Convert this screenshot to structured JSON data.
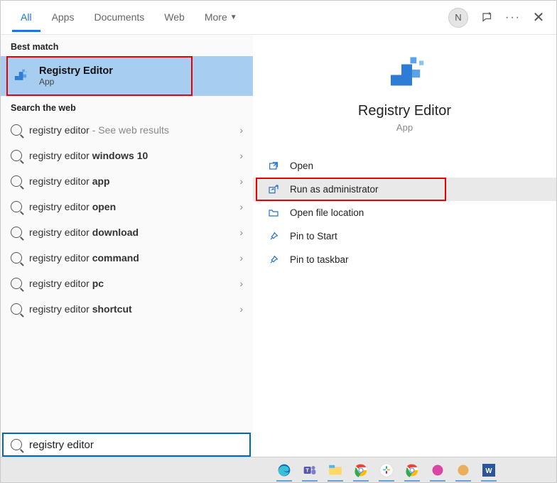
{
  "header": {
    "tabs": [
      "All",
      "Apps",
      "Documents",
      "Web",
      "More"
    ],
    "avatar_letter": "N"
  },
  "left": {
    "best_match_label": "Best match",
    "best_match": {
      "title": "Registry Editor",
      "subtitle": "App"
    },
    "search_web_label": "Search the web",
    "web_items": [
      {
        "prefix": "registry editor",
        "bold": "",
        "hint": " - See web results"
      },
      {
        "prefix": "registry editor ",
        "bold": "windows 10",
        "hint": ""
      },
      {
        "prefix": "registry editor ",
        "bold": "app",
        "hint": ""
      },
      {
        "prefix": "registry editor ",
        "bold": "open",
        "hint": ""
      },
      {
        "prefix": "registry editor ",
        "bold": "download",
        "hint": ""
      },
      {
        "prefix": "registry editor ",
        "bold": "command",
        "hint": ""
      },
      {
        "prefix": "registry editor ",
        "bold": "pc",
        "hint": ""
      },
      {
        "prefix": "registry editor ",
        "bold": "shortcut",
        "hint": ""
      }
    ]
  },
  "right": {
    "title": "Registry Editor",
    "subtitle": "App",
    "actions": [
      {
        "icon": "open",
        "label": "Open",
        "highlight": false
      },
      {
        "icon": "admin",
        "label": "Run as administrator",
        "highlight": true
      },
      {
        "icon": "folder",
        "label": "Open file location",
        "highlight": false
      },
      {
        "icon": "pin",
        "label": "Pin to Start",
        "highlight": false
      },
      {
        "icon": "pin",
        "label": "Pin to taskbar",
        "highlight": false
      }
    ]
  },
  "search": {
    "value": "registry editor"
  },
  "taskbar": {
    "icons": [
      "edge",
      "teams",
      "explorer",
      "chrome",
      "slack",
      "chrome2",
      "snip",
      "paint",
      "word"
    ]
  }
}
